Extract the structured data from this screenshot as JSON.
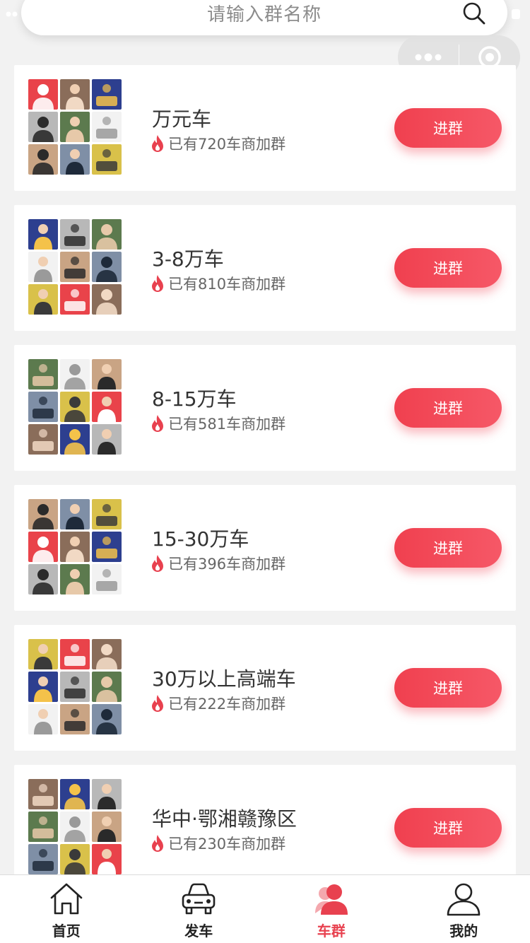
{
  "search": {
    "placeholder": "请输入群名称",
    "icon": "search-icon"
  },
  "colors": {
    "accent": "#f0404f",
    "accent_light": "#f65867",
    "flame": "#e8414f",
    "background": "#f2f2f2"
  },
  "groups": [
    {
      "name": "万元车",
      "count": "已有720车商加群",
      "button": "进群"
    },
    {
      "name": "3-8万车",
      "count": "已有810车商加群",
      "button": "进群"
    },
    {
      "name": "8-15万车",
      "count": "已有581车商加群",
      "button": "进群"
    },
    {
      "name": "15-30万车",
      "count": "已有396车商加群",
      "button": "进群"
    },
    {
      "name": "30万以上高端车",
      "count": "已有222车商加群",
      "button": "进群"
    },
    {
      "name": "华中·鄂湘赣豫区",
      "count": "已有230车商加群",
      "button": "进群"
    }
  ],
  "tabs": [
    {
      "label": "首页",
      "icon": "home-icon",
      "active": false
    },
    {
      "label": "发车",
      "icon": "car-icon",
      "active": false
    },
    {
      "label": "车群",
      "icon": "group-icon",
      "active": true
    },
    {
      "label": "我的",
      "icon": "user-icon",
      "active": false
    }
  ]
}
